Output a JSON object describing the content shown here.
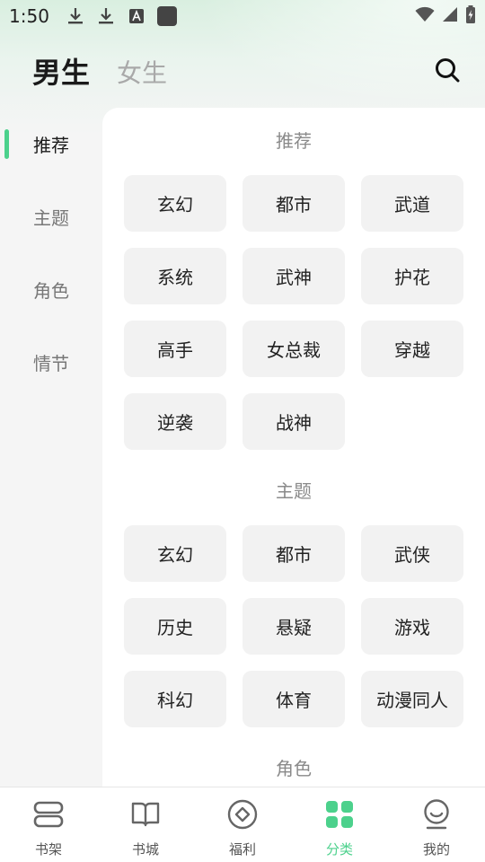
{
  "status_bar": {
    "time": "1:50"
  },
  "header": {
    "tab_male": "男生",
    "tab_female": "女生"
  },
  "side_nav": [
    {
      "label": "推荐",
      "active": true
    },
    {
      "label": "主题",
      "active": false
    },
    {
      "label": "角色",
      "active": false
    },
    {
      "label": "情节",
      "active": false
    }
  ],
  "sections": [
    {
      "title": "推荐",
      "tags": [
        "玄幻",
        "都市",
        "武道",
        "系统",
        "武神",
        "护花",
        "高手",
        "女总裁",
        "穿越",
        "逆袭",
        "战神"
      ]
    },
    {
      "title": "主题",
      "tags": [
        "玄幻",
        "都市",
        "武侠",
        "历史",
        "悬疑",
        "游戏",
        "科幻",
        "体育",
        "动漫同人"
      ]
    },
    {
      "title": "角色",
      "tags": []
    }
  ],
  "bottom_nav": [
    {
      "label": "书架",
      "icon": "bookshelf-icon"
    },
    {
      "label": "书城",
      "icon": "book-icon"
    },
    {
      "label": "福利",
      "icon": "welfare-icon"
    },
    {
      "label": "分类",
      "icon": "category-icon",
      "active": true
    },
    {
      "label": "我的",
      "icon": "profile-icon"
    }
  ],
  "colors": {
    "accent": "#4cd18c",
    "chip_bg": "#f2f2f2",
    "page_bg": "#f5f5f5"
  }
}
